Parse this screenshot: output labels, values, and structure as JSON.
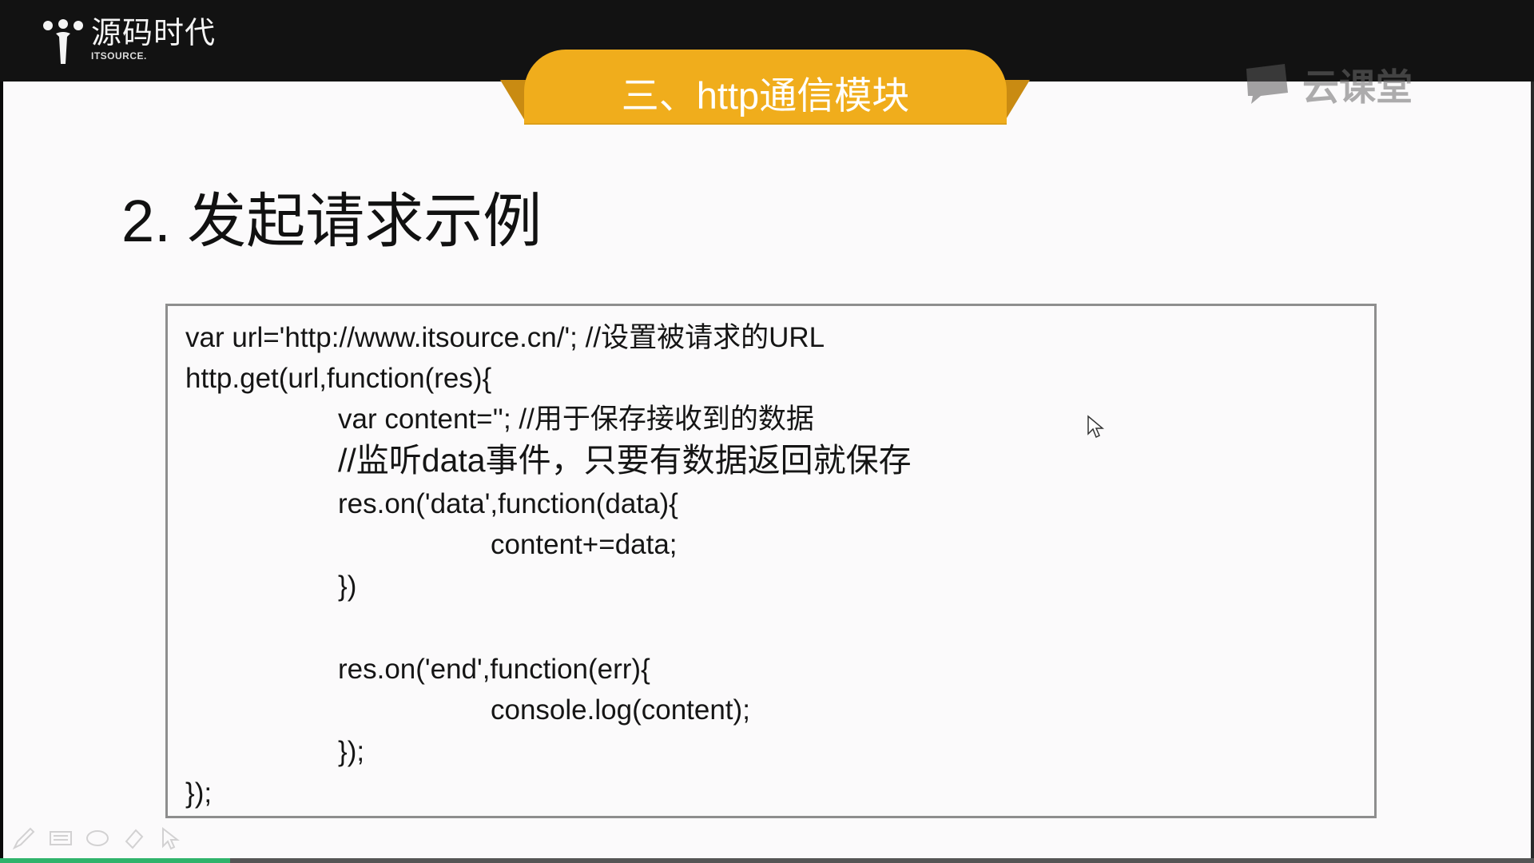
{
  "brand": {
    "name": "源码时代",
    "sub": "ITSOURCE."
  },
  "slide": {
    "section_title": "三、http通信模块",
    "watermark": "云课堂",
    "heading": "2. 发起请求示例",
    "code": [
      "var url='http://www.itsource.cn/'; //设置被请求的URL",
      "http.get(url,function(res){",
      "var content=''; //用于保存接收到的数据",
      "//监听data事件，只要有数据返回就保存",
      "res.on('data',function(data){",
      "content+=data;",
      "})",
      "res.on('end',function(err){",
      "console.log(content);",
      "});",
      "});"
    ]
  },
  "player": {
    "progress": 0.15,
    "tools": [
      "pen-icon",
      "keyboard-icon",
      "ellipse-icon",
      "eraser-icon",
      "pointer-icon"
    ]
  },
  "colors": {
    "ribbon": "#f0ad1c",
    "ribbon_wing": "#c98b12",
    "topbar": "#121212",
    "progress": "#2fb36b"
  }
}
